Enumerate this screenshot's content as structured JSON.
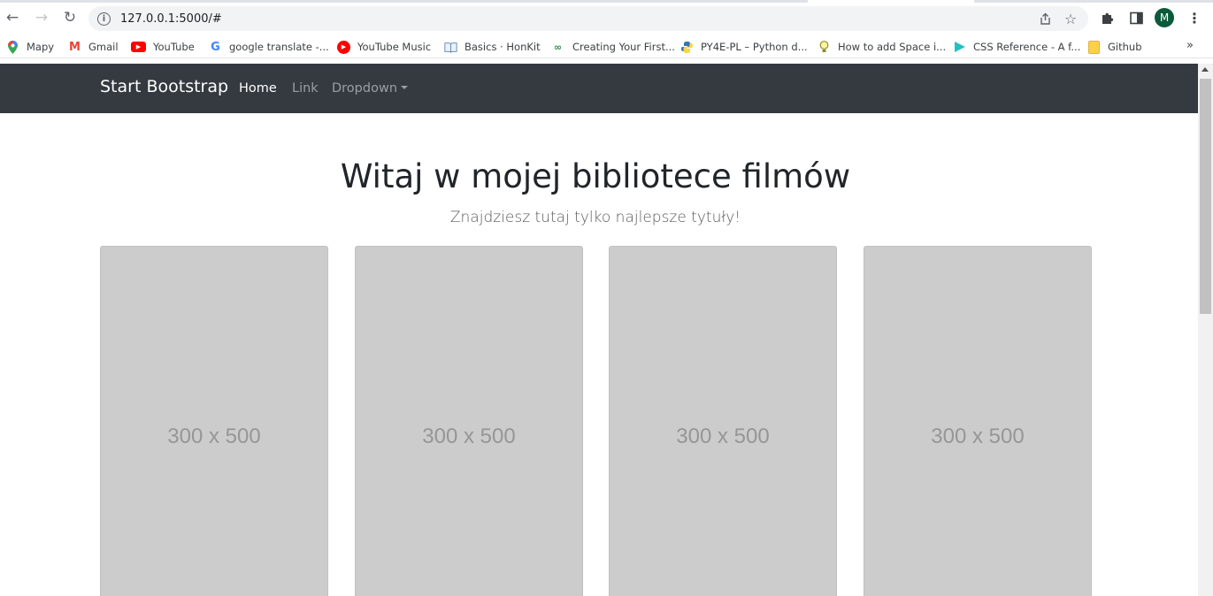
{
  "browser": {
    "url": "127.0.0.1:5000/#",
    "profile_initial": "M",
    "icons": {
      "back": "arrow-left-icon",
      "forward": "arrow-right-icon",
      "reload": "reload-icon",
      "info": "info-icon",
      "share": "share-icon",
      "star": "star-icon",
      "extensions": "puzzle-icon",
      "sidepanel": "side-panel-icon",
      "menu": "kebab-menu-icon"
    },
    "bookmarks": [
      {
        "label": "Mapy",
        "icon": "maps-pin-icon"
      },
      {
        "label": "Gmail",
        "icon": "gmail-icon"
      },
      {
        "label": "YouTube",
        "icon": "youtube-icon"
      },
      {
        "label": "google translate -...",
        "icon": "google-icon"
      },
      {
        "label": "YouTube Music",
        "icon": "youtube-music-icon"
      },
      {
        "label": "Basics · HonKit",
        "icon": "book-icon"
      },
      {
        "label": "Creating Your First...",
        "icon": "gfg-icon"
      },
      {
        "label": "PY4E-PL – Python d...",
        "icon": "python-icon"
      },
      {
        "label": "How to add Space i...",
        "icon": "lightbulb-icon"
      },
      {
        "label": "CSS Reference - A f...",
        "icon": "css-ref-icon"
      },
      {
        "label": "Github",
        "icon": "folder-icon"
      }
    ],
    "more_bookmarks": "»"
  },
  "navbar": {
    "brand": "Start Bootstrap",
    "links": [
      "Home",
      "Link",
      "Dropdown"
    ],
    "bg_color": "#343a40"
  },
  "main": {
    "title": "Witaj w mojej bibliotece filmów",
    "subtitle": "Znajdziesz tutaj tylko najlepsze tytuły!",
    "cards": [
      {
        "placeholder": "300 x 500"
      },
      {
        "placeholder": "300 x 500"
      },
      {
        "placeholder": "300 x 500"
      },
      {
        "placeholder": "300 x 500"
      }
    ]
  }
}
